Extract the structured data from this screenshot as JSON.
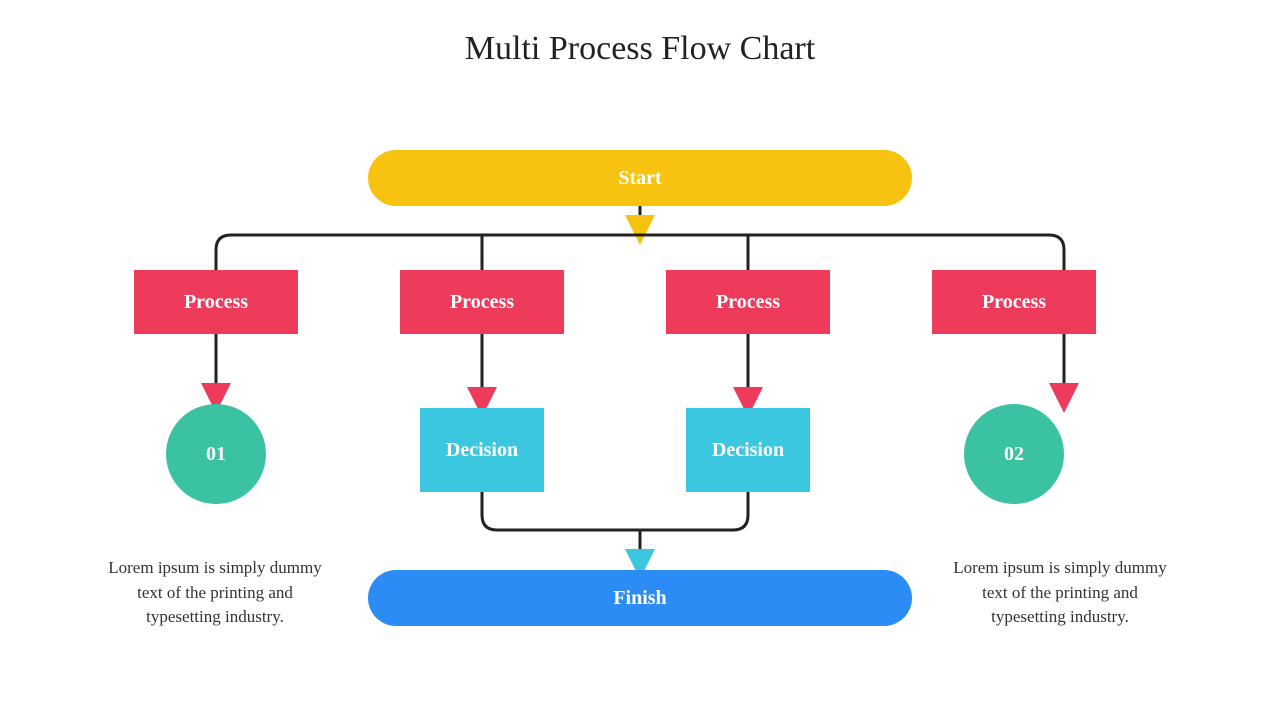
{
  "title": "Multi Process Flow Chart",
  "start": "Start",
  "processes": [
    "Process",
    "Process",
    "Process",
    "Process"
  ],
  "decisions": [
    "Decision",
    "Decision"
  ],
  "numbers": [
    "01",
    "02"
  ],
  "finish": "Finish",
  "captions": [
    "Lorem ipsum is simply dummy text of the printing and typesetting industry.",
    "Lorem ipsum is simply dummy text of the printing and typesetting industry."
  ],
  "colors": {
    "start": "#f8c210",
    "process": "#ef3b5b",
    "decision": "#3bc7e0",
    "circle": "#3bc2a3",
    "finish": "#2a8cf4",
    "line": "#222"
  }
}
